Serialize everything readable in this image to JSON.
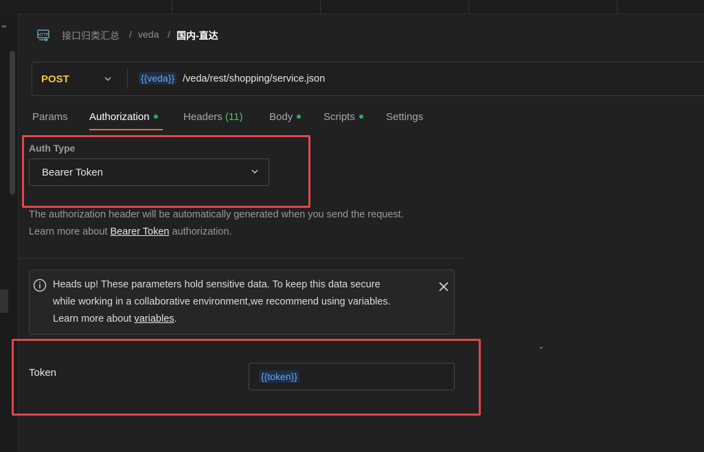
{
  "breadcrumb": {
    "icon": "http-icon",
    "collection": "接口归类汇总",
    "separator": "/",
    "folder": "veda",
    "request": "国内-直达"
  },
  "request": {
    "method": "POST",
    "url_variable": "{{veda}}",
    "url_path": " /veda/rest/shopping/service.json"
  },
  "tabs": [
    {
      "label": "Params",
      "active": false
    },
    {
      "label": "Authorization",
      "active": true,
      "dot": true
    },
    {
      "label": "Headers",
      "count": "(11)"
    },
    {
      "label": "Body",
      "dot": true
    },
    {
      "label": "Scripts",
      "dot": true
    },
    {
      "label": "Settings"
    }
  ],
  "auth": {
    "type_label": "Auth Type",
    "type_value": "Bearer Token",
    "help_line1": "The authorization header will be automatically generated when you send the request.",
    "help_learn_prefix": "Learn more about ",
    "help_link": "Bearer Token",
    "help_suffix": " authorization."
  },
  "banner": {
    "line1": "Heads up! These parameters hold sensitive data. To keep this data secure",
    "line2": "while working in a collaborative environment,we recommend using variables.",
    "learn_prefix": "Learn more about ",
    "link": "variables",
    "suffix": "."
  },
  "token": {
    "label": "Token",
    "value": "{{token}}"
  },
  "colors": {
    "accent_tab": "#f26b3a",
    "method": "#f5c542",
    "highlight": "#e0484b",
    "variable": "#6aa6f0",
    "dot": "#2fb14a"
  }
}
